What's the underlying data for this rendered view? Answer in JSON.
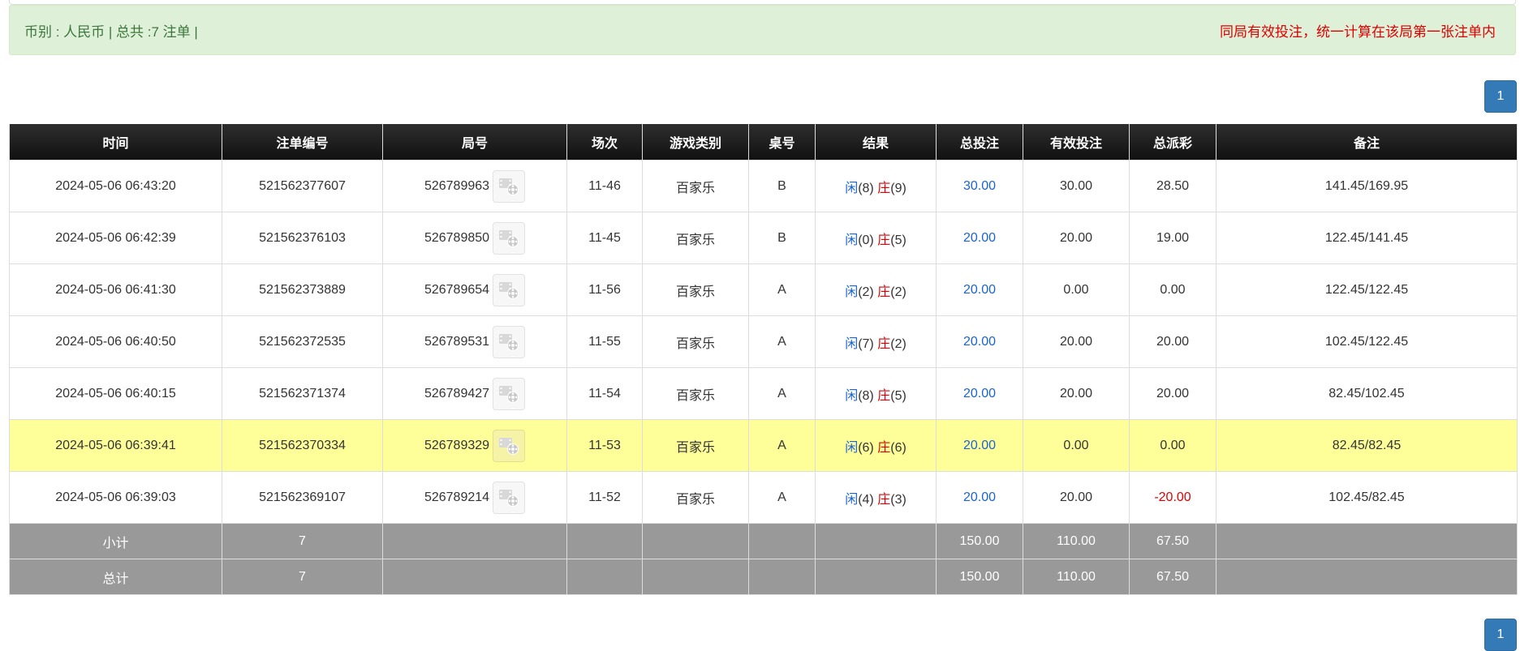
{
  "info_bar": {
    "left_text": "币别 : 人民币 | 总共 :7 注单 |",
    "right_text": "同局有效投注，统一计算在该局第一张注单内"
  },
  "pagination": {
    "current_page": "1"
  },
  "table": {
    "headers": [
      "时间",
      "注单编号",
      "局号",
      "场次",
      "游戏类别",
      "桌号",
      "结果",
      "总投注",
      "有效投注",
      "总派彩",
      "备注"
    ],
    "result_labels": {
      "player": "闲",
      "banker": "庄"
    },
    "rows": [
      {
        "time": "2024-05-06 06:43:20",
        "bet_no": "521562377607",
        "round_no": "526789963",
        "session": "11-46",
        "game_type": "百家乐",
        "table_no": "B",
        "player_score": "(8)",
        "banker_score": "(9)",
        "total_bet": "30.00",
        "valid_bet": "30.00",
        "payout": "28.50",
        "remark": "141.45/169.95"
      },
      {
        "time": "2024-05-06 06:42:39",
        "bet_no": "521562376103",
        "round_no": "526789850",
        "session": "11-45",
        "game_type": "百家乐",
        "table_no": "B",
        "player_score": "(0)",
        "banker_score": "(5)",
        "total_bet": "20.00",
        "valid_bet": "20.00",
        "payout": "19.00",
        "remark": "122.45/141.45"
      },
      {
        "time": "2024-05-06 06:41:30",
        "bet_no": "521562373889",
        "round_no": "526789654",
        "session": "11-56",
        "game_type": "百家乐",
        "table_no": "A",
        "player_score": "(2)",
        "banker_score": "(2)",
        "total_bet": "20.00",
        "valid_bet": "0.00",
        "payout": "0.00",
        "remark": "122.45/122.45"
      },
      {
        "time": "2024-05-06 06:40:50",
        "bet_no": "521562372535",
        "round_no": "526789531",
        "session": "11-55",
        "game_type": "百家乐",
        "table_no": "A",
        "player_score": "(7)",
        "banker_score": "(2)",
        "total_bet": "20.00",
        "valid_bet": "20.00",
        "payout": "20.00",
        "remark": "102.45/122.45"
      },
      {
        "time": "2024-05-06 06:40:15",
        "bet_no": "521562371374",
        "round_no": "526789427",
        "session": "11-54",
        "game_type": "百家乐",
        "table_no": "A",
        "player_score": "(8)",
        "banker_score": "(5)",
        "total_bet": "20.00",
        "valid_bet": "20.00",
        "payout": "20.00",
        "remark": "82.45/102.45"
      },
      {
        "time": "2024-05-06 06:39:41",
        "bet_no": "521562370334",
        "round_no": "526789329",
        "session": "11-53",
        "game_type": "百家乐",
        "table_no": "A",
        "player_score": "(6)",
        "banker_score": "(6)",
        "total_bet": "20.00",
        "valid_bet": "0.00",
        "payout": "0.00",
        "remark": "82.45/82.45",
        "highlight": true
      },
      {
        "time": "2024-05-06 06:39:03",
        "bet_no": "521562369107",
        "round_no": "526789214",
        "session": "11-52",
        "game_type": "百家乐",
        "table_no": "A",
        "player_score": "(4)",
        "banker_score": "(3)",
        "total_bet": "20.00",
        "valid_bet": "20.00",
        "payout": "-20.00",
        "remark": "102.45/82.45",
        "payout_negative": true
      }
    ],
    "subtotal": {
      "label": "小计",
      "count": "7",
      "total_bet": "150.00",
      "valid_bet": "110.00",
      "payout": "67.50"
    },
    "grand_total": {
      "label": "总计",
      "count": "7",
      "total_bet": "150.00",
      "valid_bet": "110.00",
      "payout": "67.50"
    }
  },
  "icons": {
    "replay": "video-replay-icon"
  },
  "colors": {
    "info_bg": "#dff0d8",
    "info_text": "#3c763d",
    "notice_text": "#e00000",
    "header_bg": "#1a1a1a",
    "highlight_row": "#ffff99",
    "summary_bg": "#999999",
    "player_blue": "#1a62d6",
    "banker_red": "#e00000",
    "pager_blue": "#337ab7"
  }
}
